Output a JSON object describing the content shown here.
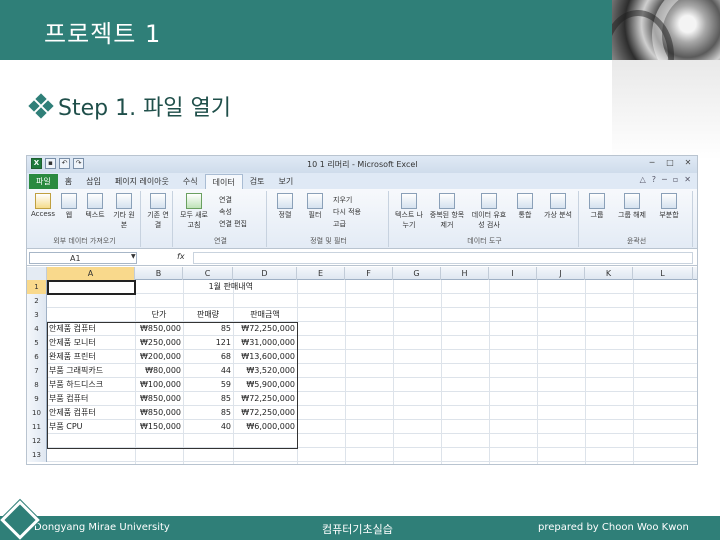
{
  "header": {
    "title": "프로젝트 1"
  },
  "step": {
    "heading": "Step 1. 파일 열기"
  },
  "excel": {
    "window_title": "10 1 리머리 - Microsoft Excel",
    "tabs": [
      "파일",
      "홈",
      "삽입",
      "페이지 레이아웃",
      "수식",
      "데이터",
      "검토",
      "보기"
    ],
    "active_tab": "데이터",
    "ribbon": {
      "groups": [
        {
          "label": "외부 데이터 가져오기",
          "buttons": [
            "Access",
            "웹",
            "텍스트",
            "기타 원본"
          ]
        },
        {
          "label": "",
          "buttons": [
            "기존 연결"
          ]
        },
        {
          "label": "연결",
          "buttons": [
            "모두 새로 고침"
          ],
          "small": [
            "연결",
            "속성",
            "연결 편집"
          ]
        },
        {
          "label": "정렬 및 필터",
          "buttons": [
            "정렬",
            "필터"
          ],
          "small": [
            "지우기",
            "다시 적용",
            "고급"
          ]
        },
        {
          "label": "데이터 도구",
          "buttons": [
            "텍스트 나누기",
            "중복된 항목 제거",
            "데이터 유효성 검사",
            "통합",
            "가상 분석"
          ]
        },
        {
          "label": "윤곽선",
          "buttons": [
            "그룹",
            "그룹 해제",
            "부분합"
          ]
        }
      ]
    },
    "name_box": "A1",
    "fx_label": "fx",
    "columns": [
      "A",
      "B",
      "C",
      "D",
      "E",
      "F",
      "G",
      "H",
      "I",
      "J",
      "K",
      "L"
    ],
    "rows": [
      {
        "n": "1",
        "cells": [
          "",
          "1월 판매내역",
          "",
          ""
        ]
      },
      {
        "n": "2",
        "cells": [
          "",
          "",
          "",
          ""
        ]
      },
      {
        "n": "3",
        "cells": [
          "",
          "단가",
          "판매량",
          "판매금액"
        ]
      },
      {
        "n": "4",
        "cells": [
          "안제품 컴퓨터",
          "₩850,000",
          "85",
          "₩72,250,000"
        ]
      },
      {
        "n": "5",
        "cells": [
          "안제품 모니터",
          "₩250,000",
          "121",
          "₩31,000,000"
        ]
      },
      {
        "n": "6",
        "cells": [
          "완제품 프린터",
          "₩200,000",
          "68",
          "₩13,600,000"
        ]
      },
      {
        "n": "7",
        "cells": [
          "부품 그래픽카드",
          "₩80,000",
          "44",
          "₩3,520,000"
        ]
      },
      {
        "n": "8",
        "cells": [
          "부품 하드디스크",
          "₩100,000",
          "59",
          "₩5,900,000"
        ]
      },
      {
        "n": "9",
        "cells": [
          "부품 컴퓨터",
          "₩850,000",
          "85",
          "₩72,250,000"
        ]
      },
      {
        "n": "10",
        "cells": [
          "안제품 컴퓨터",
          "₩850,000",
          "85",
          "₩72,250,000"
        ]
      },
      {
        "n": "11",
        "cells": [
          "부품 CPU",
          "₩150,000",
          "40",
          "₩6,000,000"
        ]
      },
      {
        "n": "12",
        "cells": [
          "",
          "",
          "",
          ""
        ]
      },
      {
        "n": "13",
        "cells": [
          "",
          "",
          "",
          ""
        ]
      }
    ]
  },
  "footer": {
    "left": "Dongyang Mirae University",
    "center": "컴퓨터기초실습",
    "right": "prepared by Choon Woo Kwon"
  },
  "colors": {
    "brand": "#2f7f78",
    "file_tab": "#2a8a3f",
    "selected_header": "#f9d98c"
  }
}
